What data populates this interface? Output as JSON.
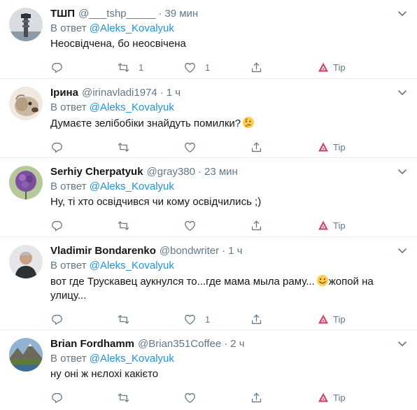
{
  "reply_prefix": "В ответ",
  "tip_label": "Tip",
  "tweets": [
    {
      "name": "ТШП",
      "handle": "@___tshp_____",
      "time": "39 мин",
      "mention": "@Aleks_Kovalyuk",
      "text": "Неосвідчена, бо неосвічена",
      "retweets": "1",
      "likes": "1"
    },
    {
      "name": "Ірина",
      "handle": "@irinavladi1974",
      "time": "1 ч",
      "mention": "@Aleks_Kovalyuk",
      "text": "Думаєте зелібобіки знайдуть помилки?",
      "emoji": "thinking-face",
      "retweets": "",
      "likes": ""
    },
    {
      "name": "Serhiy Cherpatyuk",
      "handle": "@gray380",
      "time": "23 мин",
      "mention": "@Aleks_Kovalyuk",
      "text": "Ну, ті хто освідчився чи кому освідчились ;)",
      "retweets": "",
      "likes": ""
    },
    {
      "name": "Vladimir Bondarenko",
      "handle": "@bondwriter",
      "time": "1 ч",
      "mention": "@Aleks_Kovalyuk",
      "text_before": "вот где Трускавец аукнулся то...где мама мыла раму...",
      "emoji": "smiling-face",
      "text_after": "жопой на улицу...",
      "retweets": "",
      "likes": "1"
    },
    {
      "name": "Brian Fordhamm",
      "handle": "@Brian351Coffee",
      "time": "2 ч",
      "mention": "@Aleks_Kovalyuk",
      "text": "ну оні ж нєлохі какієто",
      "retweets": "",
      "likes": ""
    }
  ]
}
